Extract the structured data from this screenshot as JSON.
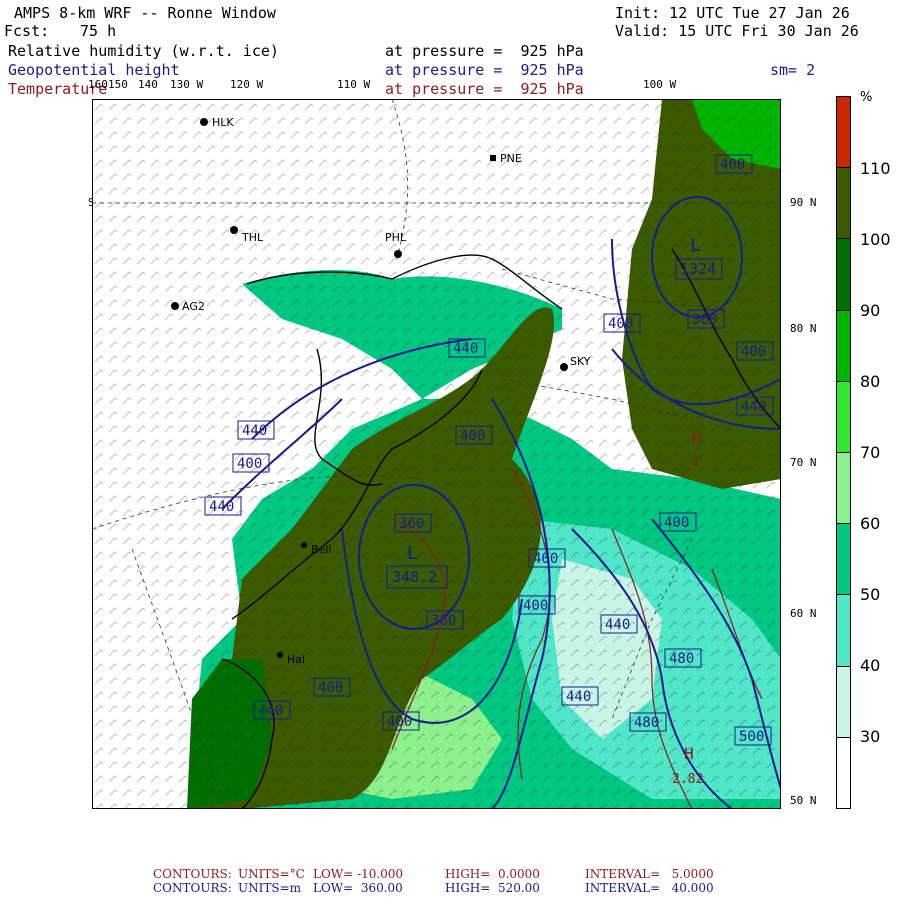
{
  "header": {
    "title": "AMPS 8-km WRF -- Ronne Window",
    "init": "Init: 12 UTC Tue 27 Jan 26",
    "fcst_label": "Fcst:",
    "fcst_value": "75 h",
    "valid": "Valid: 15 UTC Fri 30 Jan 26",
    "field1": "Relative humidity (w.r.t. ice)",
    "field2": "Geopotential height",
    "field3": "Temperature",
    "pressure_text": "at pressure =  925 hPa",
    "sm": "sm= 2"
  },
  "top_ticks": [
    "160",
    "150",
    "140",
    "130 W",
    "120 W",
    "110 W",
    "100 W"
  ],
  "right_ticks": [
    "90 N",
    "80 N",
    "70 N",
    "60 N",
    "50 N"
  ],
  "left_tick": "SP",
  "stations": [
    {
      "name": "HLK"
    },
    {
      "name": "PNE"
    },
    {
      "name": "THL"
    },
    {
      "name": "PHL"
    },
    {
      "name": "AG2"
    },
    {
      "name": "SKY"
    },
    {
      "name": "Bell"
    },
    {
      "name": "Hal"
    }
  ],
  "height_labels": [
    "400",
    "360",
    "380",
    "400",
    "440",
    "440",
    "440",
    "440",
    "400",
    "360",
    "400",
    "400",
    "440",
    "400",
    "400",
    "360",
    "400",
    "440",
    "480",
    "480",
    "500",
    "1324",
    "348.2"
  ],
  "pressure_centers": [
    {
      "type": "L",
      "value": "1324"
    },
    {
      "type": "L",
      "value": "348.2"
    },
    {
      "type": "H",
      "value": "-1"
    },
    {
      "type": "H",
      "value": "2.82"
    }
  ],
  "colorbar": {
    "unit": "%",
    "labels": [
      "110",
      "100",
      "90",
      "80",
      "70",
      "60",
      "50",
      "40",
      "30"
    ],
    "colors": [
      "#c82800",
      "#3c5a00",
      "#006e00",
      "#00b400",
      "#32e632",
      "#8cf08c",
      "#00c882",
      "#50e6c8",
      "#c8f5e6",
      "#ffffff"
    ]
  },
  "footer": {
    "temp": {
      "label": "CONTOURS:",
      "units": "UNITS=°C",
      "low": "LOW= -10.000",
      "high": "HIGH=  0.0000",
      "interval": "INTERVAL=   5.0000"
    },
    "height": {
      "label": "CONTOURS:",
      "units": "UNITS=m",
      "low": "LOW=  360.00",
      "high": "HIGH=  520.00",
      "interval": "INTERVAL=   40.000"
    }
  }
}
